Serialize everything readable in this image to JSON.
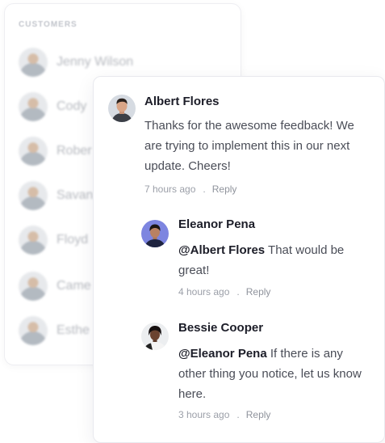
{
  "customers": {
    "title": "CUSTOMERS",
    "items": [
      {
        "name": "Jenny Wilson"
      },
      {
        "name": "Cody"
      },
      {
        "name": "Rober"
      },
      {
        "name": "Savan"
      },
      {
        "name": "Floyd"
      },
      {
        "name": "Came"
      },
      {
        "name": "Esthe"
      }
    ]
  },
  "comments": [
    {
      "author": "Albert Flores",
      "text": "Thanks for the awesome feedback! We are trying to implement this in our next update. Cheers!",
      "time": "7 hours ago",
      "separator": ".",
      "reply_label": "Reply"
    },
    {
      "author": "Eleanor Pena",
      "mention": "@Albert Flores",
      "text": " That would be great!",
      "time": "4 hours ago",
      "separator": ".",
      "reply_label": "Reply"
    },
    {
      "author": "Bessie Cooper",
      "mention": "@Eleanor Pena",
      "text": " If there is any other thing you notice, let us know here.",
      "time": "3 hours ago",
      "separator": ".",
      "reply_label": "Reply"
    }
  ]
}
